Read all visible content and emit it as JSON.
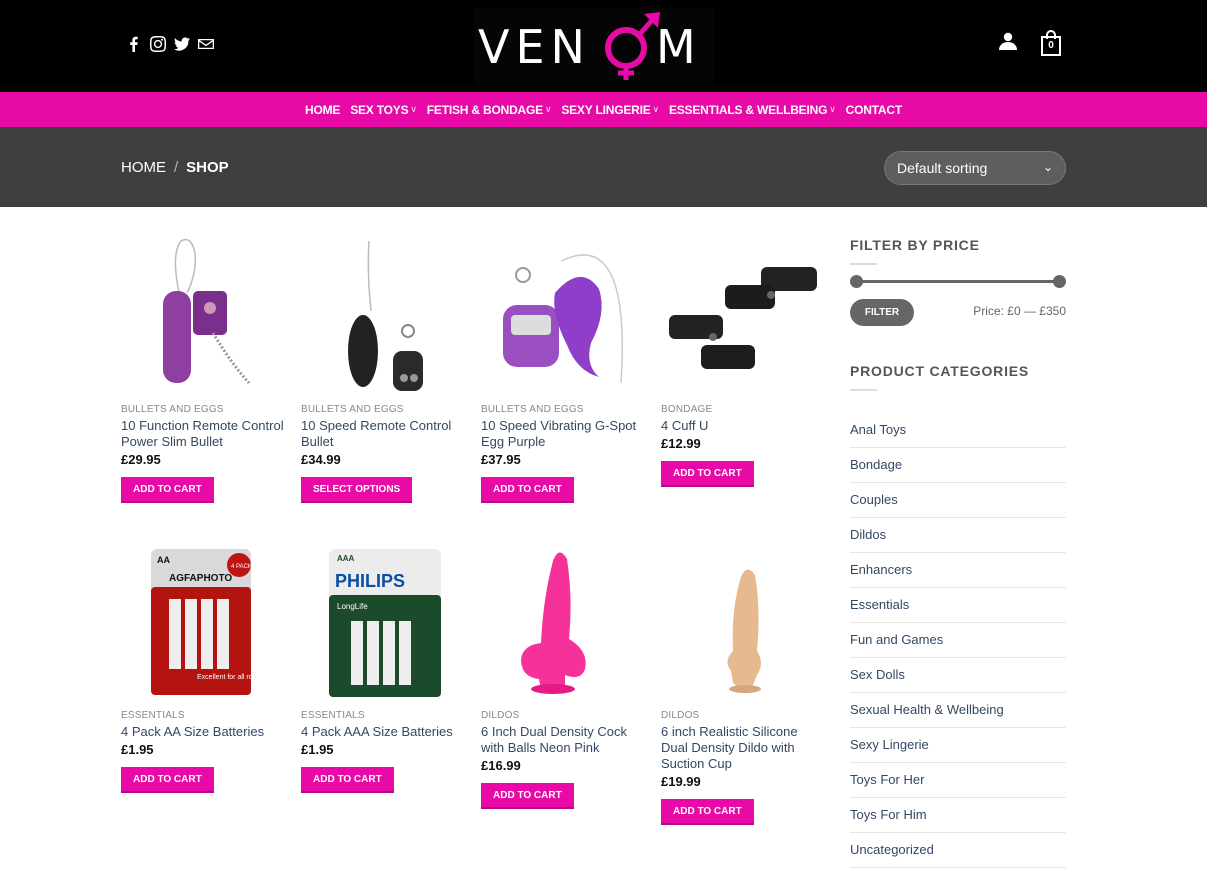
{
  "header": {
    "logo_text": "VENOM",
    "cart_count": "0",
    "social_icons": [
      "facebook-icon",
      "instagram-icon",
      "twitter-icon",
      "envelope-icon"
    ]
  },
  "nav": {
    "items": [
      {
        "label": "HOME",
        "has_dropdown": false
      },
      {
        "label": "SEX TOYS",
        "has_dropdown": true
      },
      {
        "label": "FETISH & BONDAGE",
        "has_dropdown": true
      },
      {
        "label": "SEXY LINGERIE",
        "has_dropdown": true
      },
      {
        "label": "ESSENTIALS & WELLBEING",
        "has_dropdown": true
      },
      {
        "label": "CONTACT",
        "has_dropdown": false
      }
    ]
  },
  "breadcrumb": {
    "home": "HOME",
    "sep": "/",
    "current": "SHOP"
  },
  "sort": {
    "selected": "Default sorting"
  },
  "products": [
    {
      "category": "BULLETS AND EGGS",
      "name": "10 Function Remote Control Power Slim Bullet",
      "price": "£29.95",
      "button": "ADD TO CART"
    },
    {
      "category": "BULLETS AND EGGS",
      "name": "10 Speed Remote Control Bullet",
      "price": "£34.99",
      "button": "SELECT OPTIONS"
    },
    {
      "category": "BULLETS AND EGGS",
      "name": "10 Speed Vibrating G-Spot Egg Purple",
      "price": "£37.95",
      "button": "ADD TO CART"
    },
    {
      "category": "BONDAGE",
      "name": "4 Cuff U",
      "price": "£12.99",
      "button": "ADD TO CART"
    },
    {
      "category": "ESSENTIALS",
      "name": "4 Pack AA Size Batteries",
      "price": "£1.95",
      "button": "ADD TO CART"
    },
    {
      "category": "ESSENTIALS",
      "name": "4 Pack AAA Size Batteries",
      "price": "£1.95",
      "button": "ADD TO CART"
    },
    {
      "category": "DILDOS",
      "name": "6 Inch Dual Density Cock with Balls Neon Pink",
      "price": "£16.99",
      "button": "ADD TO CART"
    },
    {
      "category": "DILDOS",
      "name": "6 inch Realistic Silicone Dual Density Dildo with Suction Cup",
      "price": "£19.99",
      "button": "ADD TO CART"
    }
  ],
  "sidebar": {
    "filter_title": "FILTER BY PRICE",
    "filter_button": "FILTER",
    "price_label": "Price: £0 — £350",
    "categories_title": "PRODUCT CATEGORIES",
    "categories": [
      "Anal Toys",
      "Bondage",
      "Couples",
      "Dildos",
      "Enhancers",
      "Essentials",
      "Fun and Games",
      "Sex Dolls",
      "Sexual Health & Wellbeing",
      "Sexy Lingerie",
      "Toys For Her",
      "Toys For Him",
      "Uncategorized"
    ]
  },
  "colors": {
    "brand_pink": "#e80aa6",
    "header_bg": "#000000",
    "titlebar_bg": "#3f3f3f",
    "link": "#334862"
  },
  "product_images": {
    "items": [
      {
        "name": "Power Slim Bullet",
        "labels": []
      },
      {
        "name": "Remote Bullet",
        "labels": []
      },
      {
        "name": "G-Spot Egg",
        "labels": []
      },
      {
        "name": "Cuffs",
        "labels": []
      },
      {
        "name": "AA Batteries",
        "labels": [
          "AA",
          "4 PACK",
          "AGFAPHOTO",
          "Excellent for all round use"
        ]
      },
      {
        "name": "AAA Batteries",
        "labels": [
          "AAA",
          "PHILIPS",
          "LongLife"
        ]
      },
      {
        "name": "Pink Dildo",
        "labels": []
      },
      {
        "name": "Realistic Dildo",
        "labels": []
      }
    ]
  }
}
